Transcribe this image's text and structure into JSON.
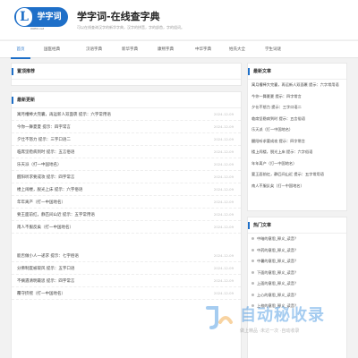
{
  "header": {
    "logo_text": "学字词",
    "logo_letter": "L",
    "logo_url": "XUECI.net",
    "title": "学字词-在线查字典",
    "description": "可以在线查询汉字的新华字典，汉字的拼音，字的部首，字的组词。"
  },
  "nav": [
    {
      "label": "首页",
      "active": true
    },
    {
      "label": "国医经典",
      "active": false
    },
    {
      "label": "汉语字典",
      "active": false
    },
    {
      "label": "新华字典",
      "active": false
    },
    {
      "label": "康熙字典",
      "active": false
    },
    {
      "label": "中华字典",
      "active": false
    },
    {
      "label": "姓氏大全",
      "active": false
    },
    {
      "label": "学生词谜",
      "active": false
    }
  ],
  "sticky": {
    "title": "置顶推荐"
  },
  "latest": {
    "title": "最新更新",
    "items": [
      {
        "text": "寓月槽棒大完囊，再运新人双面裹 提示：六字常用语",
        "date": "2024-12-09"
      },
      {
        "text": "今你一舞夏夏 提示：四字常言",
        "date": "2024-12-09"
      },
      {
        "text": "夕仕不怒力 提示：三字口语二",
        "date": "2024-12-09"
      },
      {
        "text": "临席坚稳病到时 提示：五言俗语",
        "date": "2024-12-09"
      },
      {
        "text": "乐天派（打一中国地名）",
        "date": "2024-12-09"
      },
      {
        "text": "醒阳听求要成攻 提示：四字常言",
        "date": "2024-12-09"
      },
      {
        "text": "楼上闹楼，脱光上床 提示：六字俗语",
        "date": "2024-12-09"
      },
      {
        "text": "年年离产（打一中国地名）",
        "date": "2024-12-09"
      },
      {
        "text": "要王面前红，静匹间山近 提示：五字常用语",
        "date": "2024-12-09"
      },
      {
        "text": "南人不服反矣（打一中国地名）",
        "date": "2024-12-09"
      },
      {
        "text": "能否做小人一递求 提示：七字俗语",
        "date": "2024-12-09"
      },
      {
        "text": "分佛制度被取风 提示：五字口语",
        "date": "2024-12-09"
      },
      {
        "text": "不摘遇清明最思 提示：四字常言",
        "date": "2024-12-09"
      },
      {
        "text": "覆守挤摇（打一中国地名）",
        "date": "2024-12-09"
      }
    ]
  },
  "recent": {
    "title": "最新文章",
    "items": [
      "寓月槽棒大完囊，再运新人双面裹 提示：六字常用语",
      "今你一舞夏夏 提示：四字常言",
      "夕仕不怒力 提示：三字口语二",
      "临席坚稳病到时 提示：五言俗语",
      "乐天派（打一中国地名）",
      "醒阳听求要成攻 提示：四字常言",
      "楼上闹楼，脱光上床 提示：六字俗语",
      "年年离产（打一中国地名）",
      "要王面前红，静匹间山近 提示：五字常用语",
      "南人不服反矣（打一中国地名）"
    ]
  },
  "hot": {
    "title": "热门文章",
    "items": [
      "中暗的意思_释义_读音？",
      "中药的意思_释义_读音？",
      "中暑的意思_释义_读音？",
      "下面的意思_释义_读音？",
      "上面的意思_释义_读音？",
      "上心的意思_释义_读音？",
      "上校的意思_释义_读音？"
    ]
  },
  "watermark": {
    "title": "自动秘收录",
    "subtitle": "做上精品 ·未达一次 ·自动收录"
  },
  "colors": {
    "accent": "#1e6fc8",
    "page_bg": "#f2f2f2"
  }
}
